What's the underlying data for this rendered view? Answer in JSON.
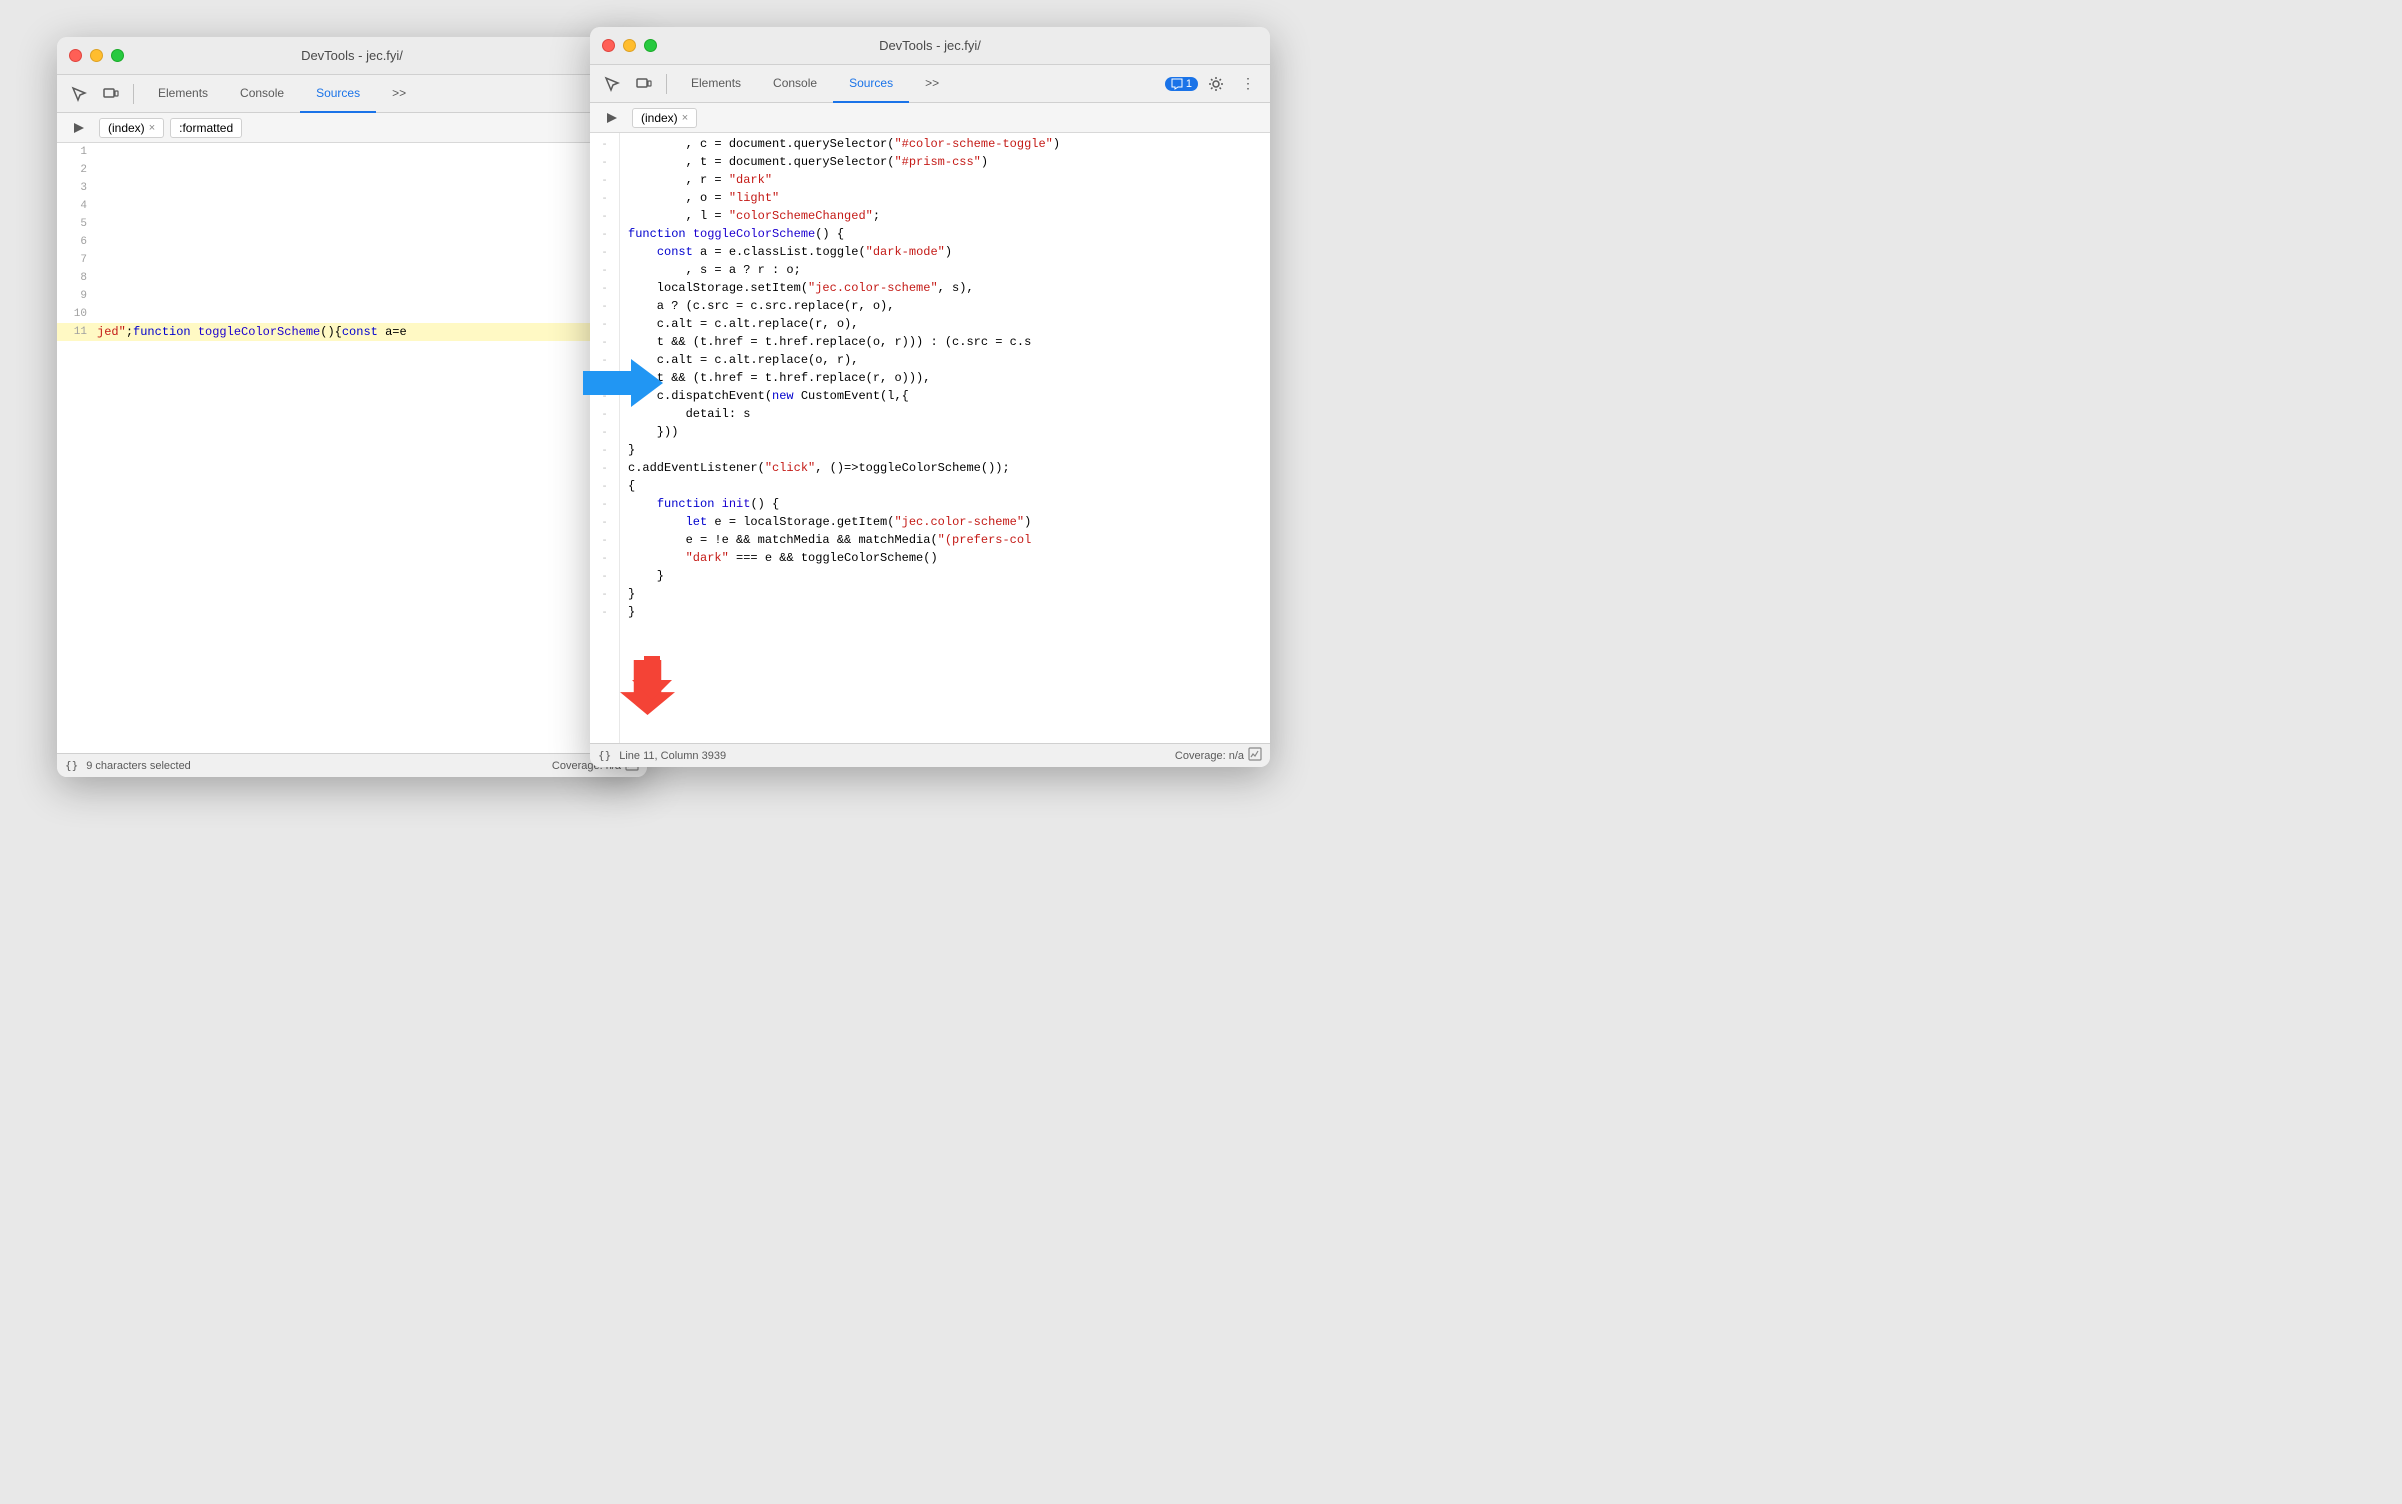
{
  "window1": {
    "title": "DevTools - jec.fyi/",
    "tabs": {
      "elements": "Elements",
      "console": "Console",
      "sources": "Sources",
      "more": ">>"
    },
    "activeTab": "Sources",
    "fileTab": "(index)",
    "fileTab2": ":formatted",
    "statusBar": {
      "format": "{}",
      "text": "9 characters selected",
      "coverage": "Coverage: n/a"
    },
    "lines": [
      {
        "num": "1",
        "content": ""
      },
      {
        "num": "2",
        "content": ""
      },
      {
        "num": "3",
        "content": ""
      },
      {
        "num": "4",
        "content": ""
      },
      {
        "num": "5",
        "content": ""
      },
      {
        "num": "6",
        "content": ""
      },
      {
        "num": "7",
        "content": ""
      },
      {
        "num": "8",
        "content": ""
      },
      {
        "num": "9",
        "content": ""
      },
      {
        "num": "10",
        "content": ""
      },
      {
        "num": "11",
        "content": "jed\";function toggleColorScheme(){const a=e"
      }
    ]
  },
  "window2": {
    "title": "DevTools - jec.fyi/",
    "tabs": {
      "elements": "Elements",
      "console": "Console",
      "sources": "Sources",
      "more": ">>"
    },
    "activeTab": "Sources",
    "fileTab": "(index)",
    "badge": "1",
    "statusBar": {
      "format": "{}",
      "location": "Line 11, Column 3939",
      "coverage": "Coverage: n/a"
    },
    "code": [
      ", c = document.querySelector(\"#color-scheme-toggle\")",
      ", t = document.querySelector(\"#prism-css\")",
      ", r = \"dark\"",
      ", o = \"light\"",
      ", l = \"colorSchemeChanged\";",
      "function toggleColorScheme() {",
      "    const a = e.classList.toggle(\"dark-mode\")",
      "        , s = a ? r : o;",
      "    localStorage.setItem(\"jec.color-scheme\", s),",
      "    a ? (c.src = c.src.replace(r, o),",
      "    c.alt = c.alt.replace(r, o),",
      "    t && (t.href = t.href.replace(o, r))) : (c.src = c.s",
      "    c.alt = c.alt.replace(o, r),",
      "    t && (t.href = t.href.replace(r, o))),",
      "    c.dispatchEvent(new CustomEvent(l,{",
      "        detail: s",
      "    }))",
      "}",
      "c.addEventListener(\"click\", ()=>toggleColorScheme());",
      "{",
      "    function init() {",
      "        let e = localStorage.getItem(\"jec.color-scheme\")",
      "        e = !e && matchMedia && matchMedia(\"(prefers-col",
      "        \"dark\" === e && toggleColorScheme()",
      "    }",
      "}",
      "}"
    ]
  }
}
